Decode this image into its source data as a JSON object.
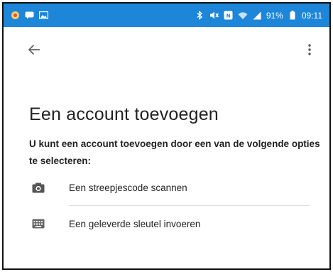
{
  "status_bar": {
    "battery_text": "91%",
    "time": "09:11",
    "background_color": "#1d86d9",
    "left_icons": [
      "app-notification-icon",
      "message-icon",
      "gallery-icon"
    ],
    "right_icons": [
      "bluetooth-icon",
      "mute-icon",
      "nfc-icon",
      "wifi-icon",
      "signal-icon",
      "battery-icon"
    ]
  },
  "toolbar": {
    "back_icon": "arrow-left-icon",
    "menu_icon": "more-vert-icon"
  },
  "page": {
    "title": "Een account toevoegen",
    "description": "U kunt een account toevoegen door een van de volgende opties te selecteren:"
  },
  "options": [
    {
      "label": "Een streepjescode scannen",
      "icon": "camera-icon"
    },
    {
      "label": "Een geleverde sleutel invoeren",
      "icon": "keyboard-icon"
    }
  ]
}
